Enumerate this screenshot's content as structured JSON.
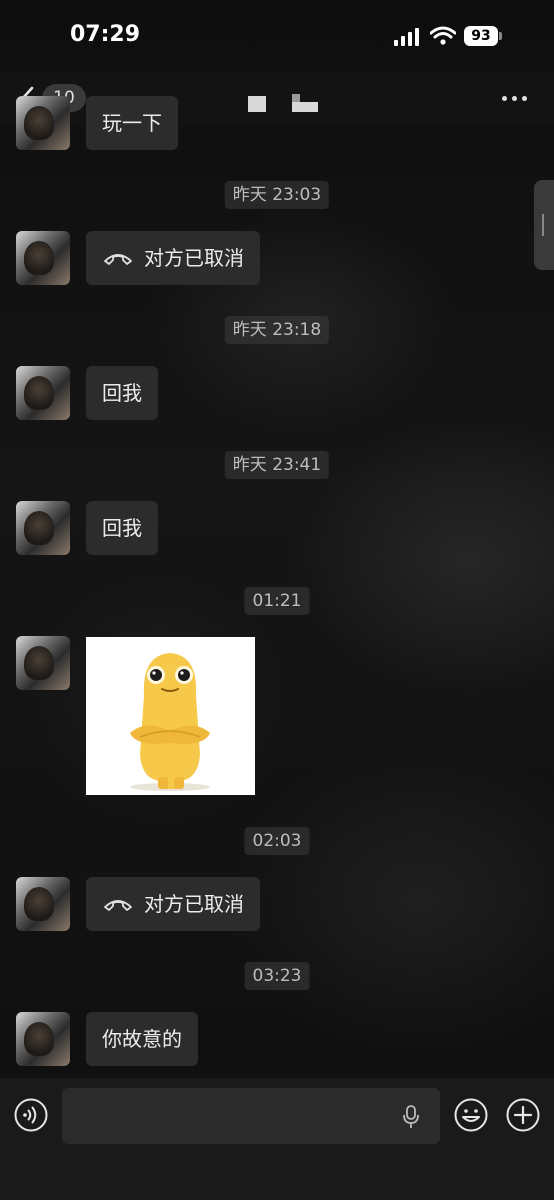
{
  "status_bar": {
    "time": "07:29",
    "battery": "93"
  },
  "nav": {
    "unread_count": "10",
    "title": ""
  },
  "messages": [
    {
      "type": "text",
      "text": "玩一下"
    },
    {
      "type": "timestamp",
      "text": "昨天 23:03"
    },
    {
      "type": "call",
      "text": "对方已取消"
    },
    {
      "type": "timestamp",
      "text": "昨天 23:18"
    },
    {
      "type": "text",
      "text": "回我"
    },
    {
      "type": "timestamp",
      "text": "昨天 23:41"
    },
    {
      "type": "text",
      "text": "回我"
    },
    {
      "type": "timestamp",
      "text": "01:21"
    },
    {
      "type": "image",
      "icon": "yellow-character-sticker"
    },
    {
      "type": "timestamp",
      "text": "02:03"
    },
    {
      "type": "call",
      "text": "对方已取消"
    },
    {
      "type": "timestamp",
      "text": "03:23"
    },
    {
      "type": "text",
      "text": "你故意的"
    }
  ],
  "input": {
    "placeholder": "",
    "value": ""
  },
  "icons": {
    "back": "back-arrow-icon",
    "more": "more-icon",
    "voice": "voice-icon",
    "mic": "mic-icon",
    "emoji": "emoji-icon",
    "plus": "plus-icon",
    "call": "phone-hangup-icon"
  },
  "colors": {
    "bubble": "#2c2c2c",
    "sticker": "#f6c94a",
    "background": "#0d0d0d"
  }
}
